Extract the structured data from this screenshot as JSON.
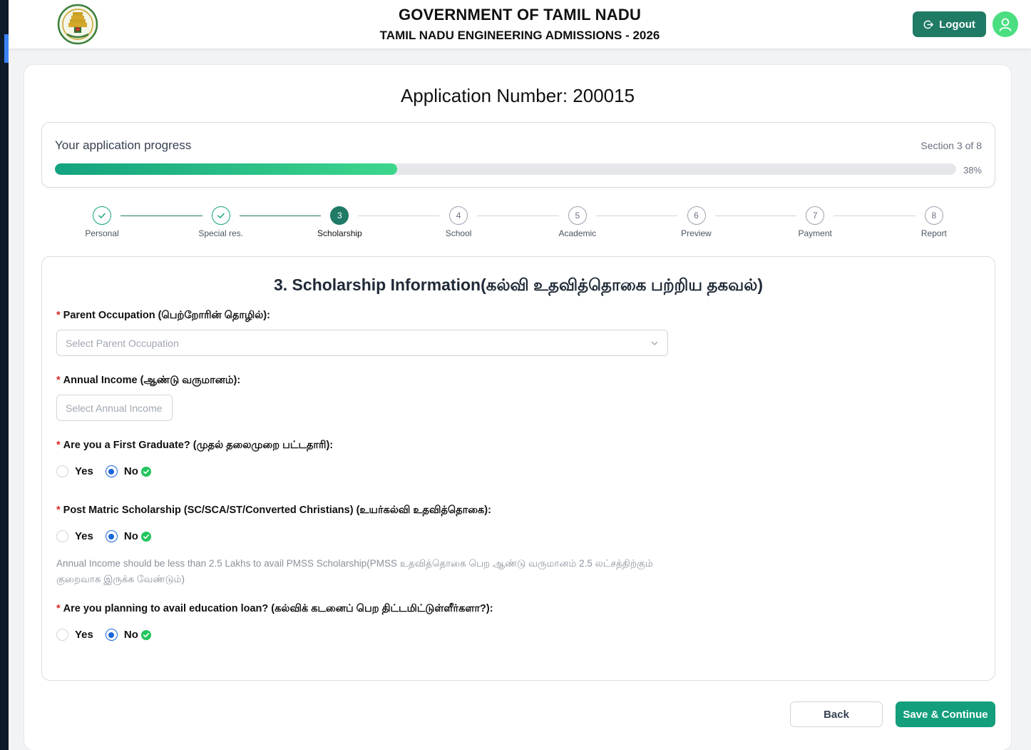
{
  "header": {
    "title": "GOVERNMENT OF TAMIL NADU",
    "subtitle": "TAMIL NADU ENGINEERING ADMISSIONS - 2026",
    "logout_label": "Logout",
    "emblem_icon": "tamil-nadu-emblem-icon",
    "avatar_icon": "user-icon"
  },
  "application": {
    "number_label": "Application Number: 200015"
  },
  "progress": {
    "label": "Your application progress",
    "section_text": "Section 3 of 8",
    "percent_text": "38%",
    "percent": 38
  },
  "steps": [
    {
      "num": "1",
      "label": "Personal",
      "state": "done"
    },
    {
      "num": "2",
      "label": "Special res.",
      "state": "done"
    },
    {
      "num": "3",
      "label": "Scholarship",
      "state": "current"
    },
    {
      "num": "4",
      "label": "School",
      "state": "todo"
    },
    {
      "num": "5",
      "label": "Academic",
      "state": "todo"
    },
    {
      "num": "6",
      "label": "Preview",
      "state": "todo"
    },
    {
      "num": "7",
      "label": "Payment",
      "state": "todo"
    },
    {
      "num": "8",
      "label": "Report",
      "state": "todo"
    }
  ],
  "form": {
    "title": "3. Scholarship Information(கல்வி உதவித்தொகை பற்றிய தகவல்)",
    "parent_occupation": {
      "label": "Parent Occupation (பெற்றோரின் தொழில்):",
      "placeholder": "Select Parent Occupation"
    },
    "annual_income": {
      "label": "Annual Income (ஆண்டு வருமானம்):",
      "placeholder": "Select Annual Income"
    },
    "first_graduate": {
      "label": "Are you a First Graduate? (முதல் தலைமுறை பட்டதாரி):",
      "yes": "Yes",
      "no": "No",
      "selected": "No"
    },
    "post_matric": {
      "label": "Post Matric Scholarship (SC/SCA/ST/Converted Christians) (உயர்கல்வி உதவித்தொகை):",
      "yes": "Yes",
      "no": "No",
      "selected": "No",
      "note": "Annual Income should be less than 2.5 Lakhs to avail PMSS Scholarship(PMSS உதவித்தொகை பெற ஆண்டு வருமானம் 2.5 லட்சத்திற்கும் குறைவாக இருக்க வேண்டும்)"
    },
    "education_loan": {
      "label": "Are you planning to avail education loan? (கல்விக் கடனைப் பெற திட்டமிட்டுள்ளீர்களா?):",
      "yes": "Yes",
      "no": "No",
      "selected": "No"
    }
  },
  "actions": {
    "back_label": "Back",
    "save_label": "Save & Continue"
  },
  "colors": {
    "primary": "#1f7a66",
    "accent_green": "#13a37f",
    "radio_blue": "#1a66d9",
    "required_red": "#dc2626"
  }
}
